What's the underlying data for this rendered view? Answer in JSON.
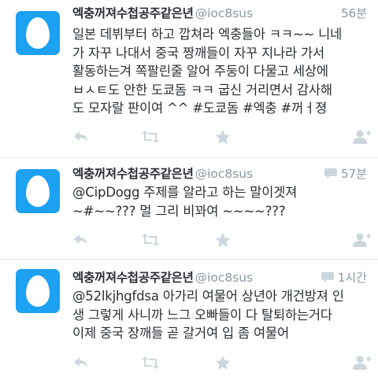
{
  "colors": {
    "avatar_bg": "#1da1f2",
    "name": "#292f33",
    "meta": "#8899a6",
    "icon": "#ccd6dd",
    "divider": "#e1e8ed"
  },
  "tweets": [
    {
      "name": "엑충꺼져수첩공주같은년",
      "handle": "@ioc8sus",
      "time": "56분",
      "is_reply": false,
      "lines": [
        "일본 데뷔부터 하고 깝쳐라 엑충들아 ㅋㅋ~~ 니네",
        "가 자꾸 나대서 중국 짱깨들이 자꾸 지나라 가서",
        "활동하는겨 쪽팔린줄 알어 주둥이 다물고 세상에",
        "ㅂㅅㅌ도 안한 도쿄돔 ㅋㅋ 굽신 거리면서 감사해",
        "도 모자랄 판이여 ^^ #도쿄돔 #엑충 #꺼ㅓ졍"
      ]
    },
    {
      "name": "엑충꺼져수첩공주같은년",
      "handle": "@ioc8sus",
      "time": "57분",
      "is_reply": true,
      "lines": [
        "@CipDogg 주제를 알라고 하는 말이겟져",
        "~#~~??? 멀 그리 비꽈여 ~~~~???"
      ]
    },
    {
      "name": "엑충꺼져수첩공주같은년",
      "handle": "@ioc8sus",
      "time": "1시간",
      "is_reply": true,
      "lines": [
        "@52lkjhgfdsa 아가리 여물어 상년아 개건방져 인",
        "생 그렇게 사니까 느그 오빠들이 다 탈퇴하는거다",
        "이제 중국 장깨들 곧 갈거여 입 좀 여물어"
      ]
    }
  ],
  "icons": {
    "avatar": "egg-avatar-icon",
    "reply": "reply-icon",
    "retweet": "retweet-icon",
    "favorite": "star-icon",
    "follow": "follow-user-icon",
    "reply_badge": "speech-bubble-icon"
  }
}
